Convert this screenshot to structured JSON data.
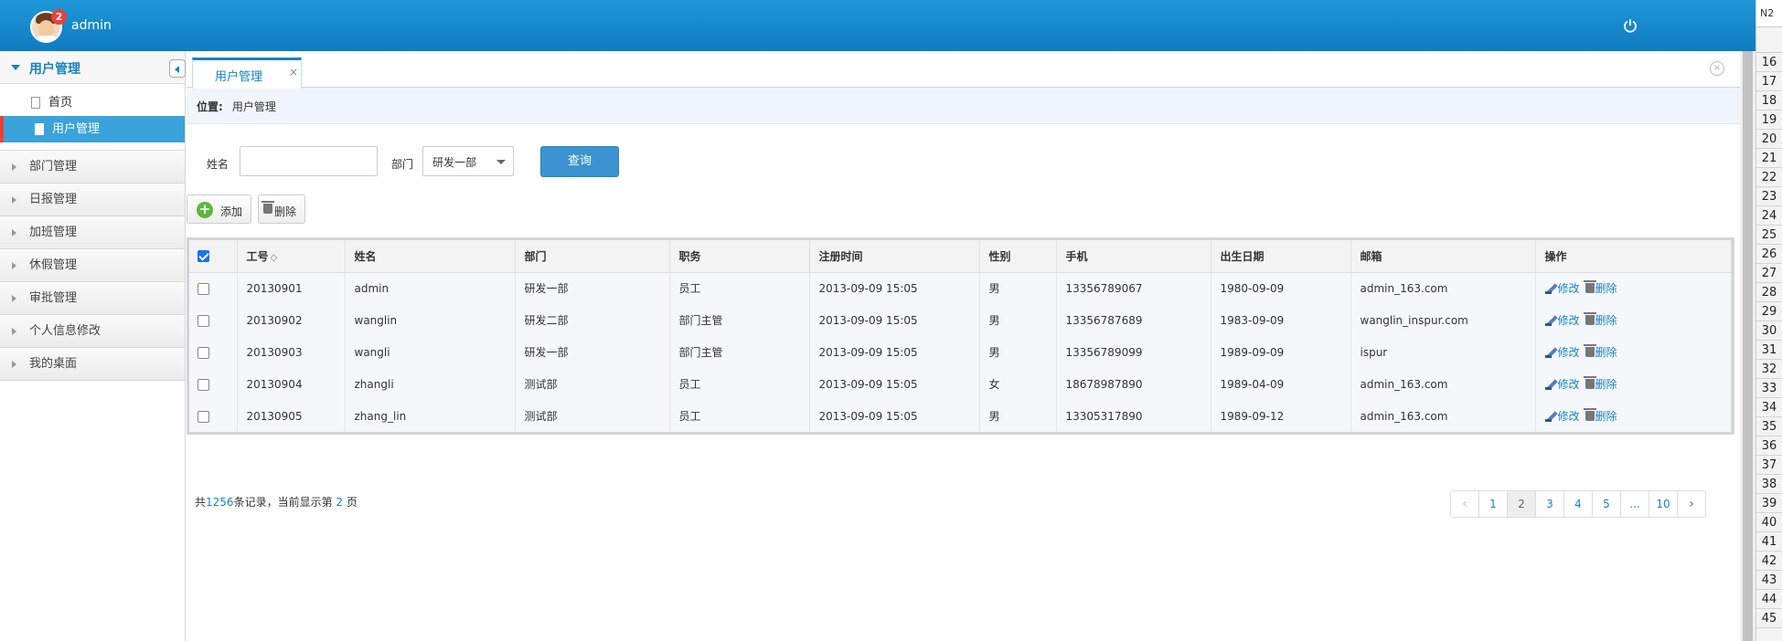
{
  "header": {
    "username": "admin",
    "notification_count": "2",
    "accent_color": "#1e97d8"
  },
  "sidebar": {
    "active_menu": "用户管理",
    "sub_items": [
      {
        "label": "首页",
        "active": false
      },
      {
        "label": "用户管理",
        "active": true
      }
    ],
    "sections": [
      "部门管理",
      "日报管理",
      "加班管理",
      "休假管理",
      "审批管理",
      "个人信息修改",
      "我的桌面"
    ]
  },
  "tab": {
    "label": "用户管理",
    "close": "×"
  },
  "breadcrumb": {
    "key": "位置:",
    "value": "用户管理"
  },
  "search": {
    "name_label": "姓名",
    "name_value": "",
    "dept_label": "部门",
    "dept_selected": "研发一部",
    "query_label": "查询"
  },
  "toolbar": {
    "add_label": "添加",
    "delete_label": "删除"
  },
  "table": {
    "columns": [
      "工号",
      "姓名",
      "部门",
      "职务",
      "注册时间",
      "性别",
      "手机",
      "出生日期",
      "邮箱",
      "操作"
    ],
    "sort_glyph": "◇",
    "edit_label": "修改",
    "delete_label": "删除",
    "rows": [
      [
        "20130901",
        "admin",
        "研发一部",
        "员工",
        "2013-09-09 15:05",
        "男",
        "13356789067",
        "1980-09-09",
        "admin_163.com"
      ],
      [
        "20130902",
        "wanglin",
        "研发二部",
        "部门主管",
        "2013-09-09 15:05",
        "男",
        "13356787689",
        "1983-09-09",
        "wanglin_inspur.com"
      ],
      [
        "20130903",
        "wangli",
        "研发一部",
        "部门主管",
        "2013-09-09 15:05",
        "男",
        "13356789099",
        "1989-09-09",
        "ispur"
      ],
      [
        "20130904",
        "zhangli",
        "测试部",
        "员工",
        "2013-09-09 15:05",
        "女",
        "18678987890",
        "1989-04-09",
        "admin_163.com"
      ],
      [
        "20130905",
        "zhang_lin",
        "测试部",
        "员工",
        "2013-09-09 15:05",
        "男",
        "13305317890",
        "1989-09-12",
        "admin_163.com"
      ]
    ]
  },
  "footer": {
    "prefix": "共",
    "total": "1256",
    "mid": "条记录，当前显示第 ",
    "page": "2",
    "suffix": " 页"
  },
  "pager": {
    "prev": "‹",
    "pages": [
      "1",
      "2",
      "3",
      "4",
      "5",
      "...",
      "10"
    ],
    "current": "2",
    "next": "›"
  },
  "right_strip": {
    "cell": "N2",
    "rows": [
      "16",
      "17",
      "18",
      "19",
      "20",
      "21",
      "22",
      "23",
      "24",
      "25",
      "26",
      "27",
      "28",
      "29",
      "30",
      "31",
      "32",
      "33",
      "34",
      "35",
      "36",
      "37",
      "38",
      "39",
      "40",
      "41",
      "42",
      "43",
      "44",
      "45"
    ]
  }
}
